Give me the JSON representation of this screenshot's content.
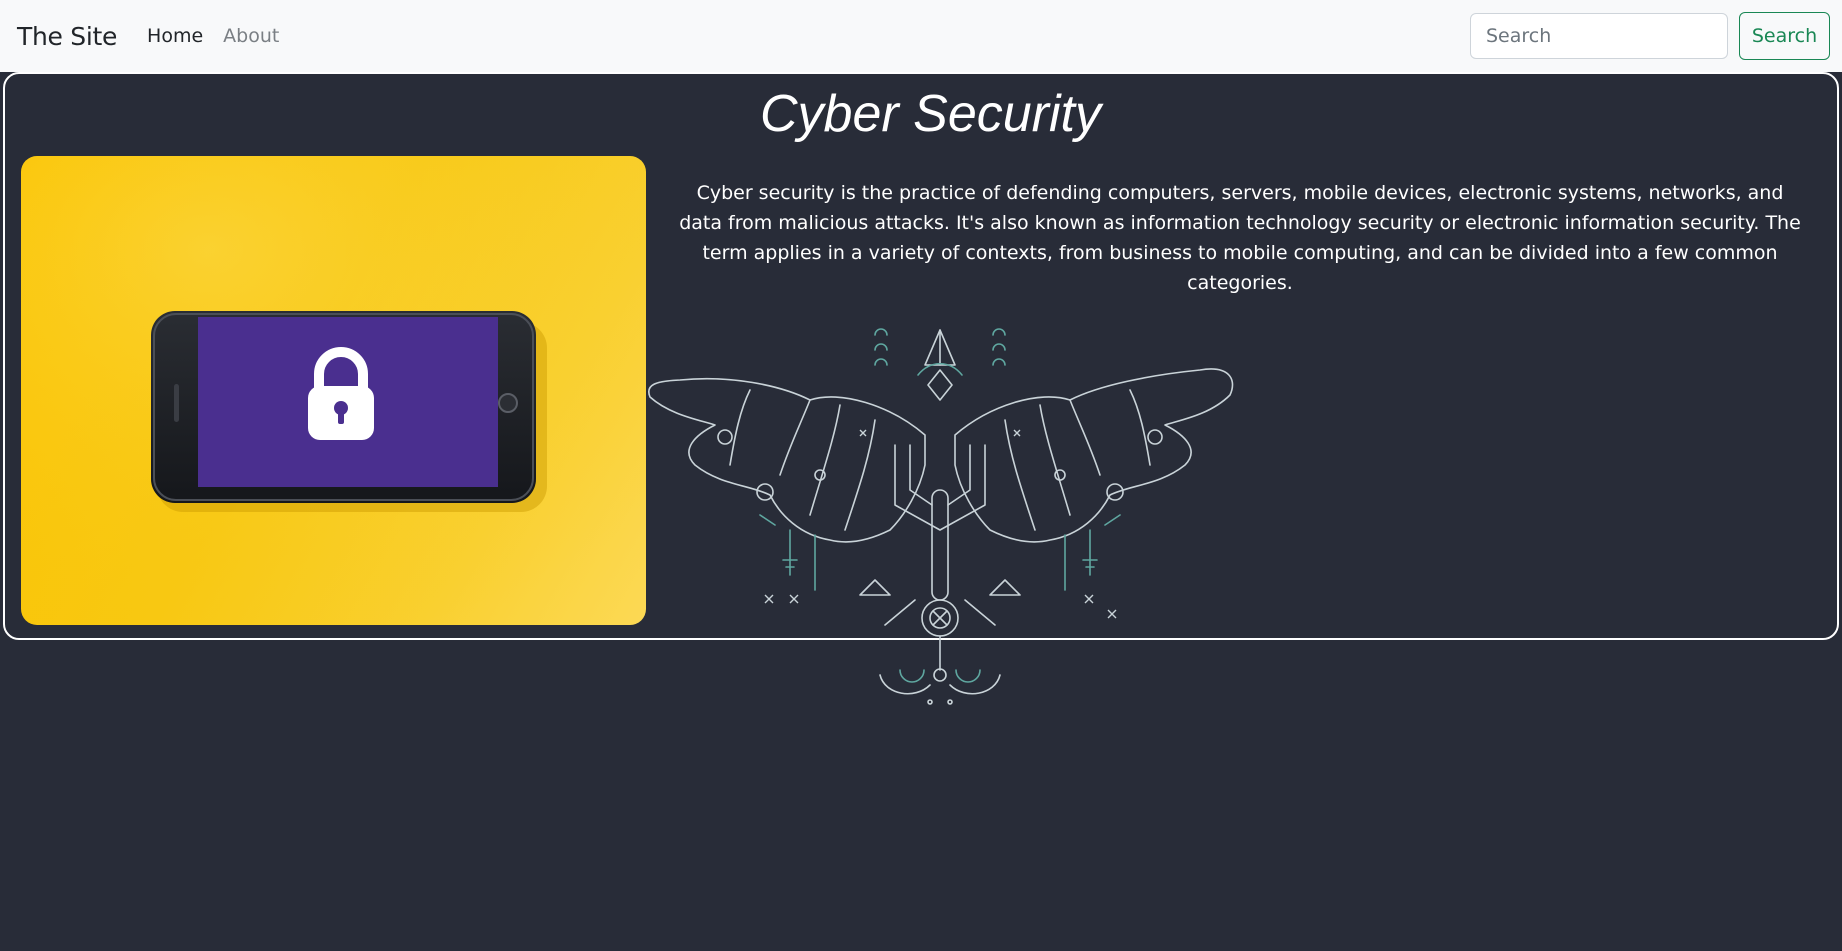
{
  "navbar": {
    "brand": "The Site",
    "links": [
      {
        "label": "Home",
        "active": true
      },
      {
        "label": "About",
        "active": false
      }
    ],
    "search_placeholder": "Search",
    "search_button": "Search"
  },
  "card": {
    "title": "Cyber Security",
    "description": "Cyber security is the practice of defending computers, servers, mobile devices, electronic systems, networks, and data from malicious attacks. It's also known as information technology security or electronic information security. The term applies in a variety of contexts, from business to mobile computing, and can be divided into a few common categories.",
    "image_subject": "phone-with-lock-icon",
    "emblem_subject": "circuit-winged-emblem"
  },
  "colors": {
    "page_bg": "#282c38",
    "navbar_bg": "#f8f9fa",
    "search_button": "#198754",
    "photo_yellow": "#fbc400",
    "phone_screen": "#4a2f8f",
    "emblem_line": "#c9d3d8",
    "emblem_teal": "#5fa7a0"
  }
}
